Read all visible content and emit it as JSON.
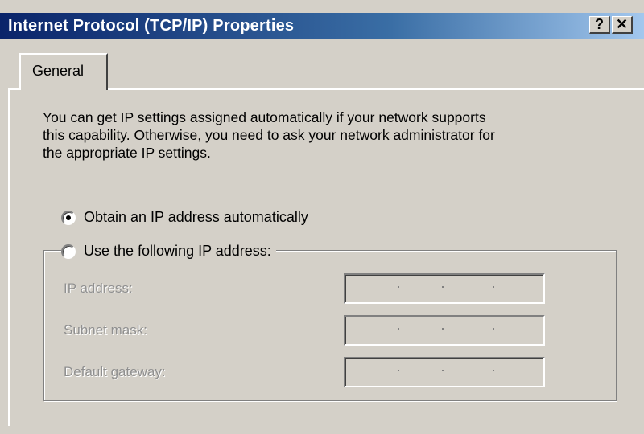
{
  "window": {
    "title": "Internet Protocol (TCP/IP) Properties",
    "help_button": "?",
    "close_button": "✕"
  },
  "tabs": [
    {
      "label": "General",
      "selected": true
    }
  ],
  "description": {
    "line1": "You can get IP settings assigned automatically if your network supports",
    "line2": "this capability. Otherwise, you need to ask your network administrator for",
    "line3": "the appropriate IP settings."
  },
  "options": {
    "auto": {
      "label": "Obtain an IP address automatically",
      "checked": true
    },
    "manual": {
      "label": "Use the following IP address:",
      "checked": false
    }
  },
  "fields": [
    {
      "label": "IP address:",
      "value": "",
      "enabled": false
    },
    {
      "label": "Subnet mask:",
      "value": "",
      "enabled": false
    },
    {
      "label": "Default gateway:",
      "value": "",
      "enabled": false
    }
  ],
  "colors": {
    "titlebar_start": "#0a246a",
    "titlebar_end": "#a6caf0",
    "face": "#d4d0c8",
    "disabled_text": "#8f8f8f"
  }
}
